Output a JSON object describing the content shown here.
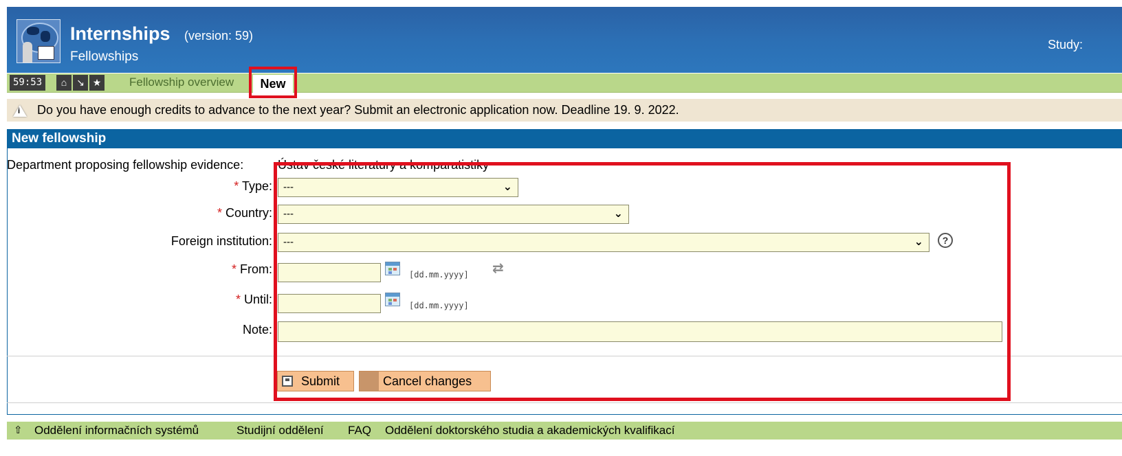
{
  "header": {
    "title": "Internships",
    "version": "(version: 59)",
    "subtitle": "Fellowships",
    "study_label": "Study:"
  },
  "tabbar": {
    "timer": "59:53",
    "icons": [
      "home-icon",
      "arrow-icon",
      "star-icon"
    ],
    "tabs": [
      {
        "label": "Fellowship overview",
        "active": false
      },
      {
        "label": "New",
        "active": true
      }
    ]
  },
  "notice": {
    "text": "Do you have enough credits to advance to the next year? Submit an electronic application now. Deadline 19. 9. 2022."
  },
  "panel": {
    "title": "New fellowship",
    "department_label": "Department proposing fellowship evidence:",
    "department_value": "Ústav české literatury a komparatistiky",
    "fields": {
      "type": {
        "label": "Type:",
        "required": true,
        "value": "---"
      },
      "country": {
        "label": "Country:",
        "required": true,
        "value": "---"
      },
      "institution": {
        "label": "Foreign institution:",
        "required": false,
        "value": "---"
      },
      "from": {
        "label": "From:",
        "required": true,
        "value": "",
        "hint": "[dd.mm.yyyy]"
      },
      "until": {
        "label": "Until:",
        "required": true,
        "value": "",
        "hint": "[dd.mm.yyyy]"
      },
      "note": {
        "label": "Note:",
        "required": false,
        "value": ""
      }
    },
    "required_mark": "*",
    "buttons": {
      "submit": "Submit",
      "cancel": "Cancel changes"
    }
  },
  "footer": {
    "links": [
      "Oddělení informačních systémů",
      "Studijní oddělení",
      "FAQ",
      "Oddělení doktorského studia a akademických kvalifikací"
    ]
  },
  "colors": {
    "header_blue": "#2c6fb4",
    "tabbar_green": "#b9d78a",
    "panel_blue": "#0b64a1",
    "input_bg": "#fbfbdc",
    "button_orange": "#f7c08f",
    "highlight_red": "#e0101e"
  }
}
